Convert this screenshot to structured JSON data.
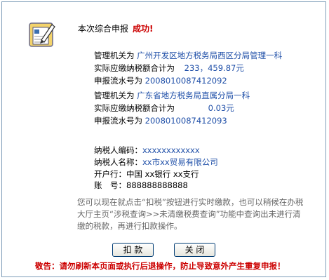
{
  "header": {
    "title": "本次综合申报",
    "status": "成功!"
  },
  "records": [
    {
      "authority_label": "管理机关为",
      "authority_value": "广州开发区地方税务局西区分局管理一科",
      "tax_label": "实际应缴纳税额合计为",
      "tax_value": "233，459.87元",
      "serial_label": "申报流水号为",
      "serial_value": "2008010087412092"
    },
    {
      "authority_label": "管理机关为",
      "authority_value": "广东省地方税务局直属分局一科",
      "tax_label": "实际应缴纳税额合计为",
      "tax_value": "0.03元",
      "serial_label": "申报流水号为",
      "serial_value": "2008010087412093"
    }
  ],
  "taxpayer": {
    "id_label": "纳税人编码：",
    "id_value": "xxxxxxxxxxxx",
    "name_label": "纳税人名称：",
    "name_value": "xx市xx贸易有限公司",
    "bank_label": "开户行：",
    "bank_value": "中国 xx银行 xx支行",
    "account_label": "账　号：",
    "account_value": "888888888888"
  },
  "note": "您可以现在就点击“扣税”按钮进行实时缴款，也可以稍候在办税大厅主页“涉税查询>>未清缴税费查询”功能中查询出未进行清缴的税款，再进行扣款操作。",
  "buttons": {
    "pay": "扣 款",
    "close": "关 闭"
  },
  "warning": "敬告：请勿刷新本页面或执行后退操作，防止导致意外产生重复申报！",
  "colors": {
    "accent_blue": "#1f4fa8",
    "success_red": "#cc0000",
    "border": "#7f9db9"
  },
  "icons": {
    "form": "edit-form-icon"
  }
}
